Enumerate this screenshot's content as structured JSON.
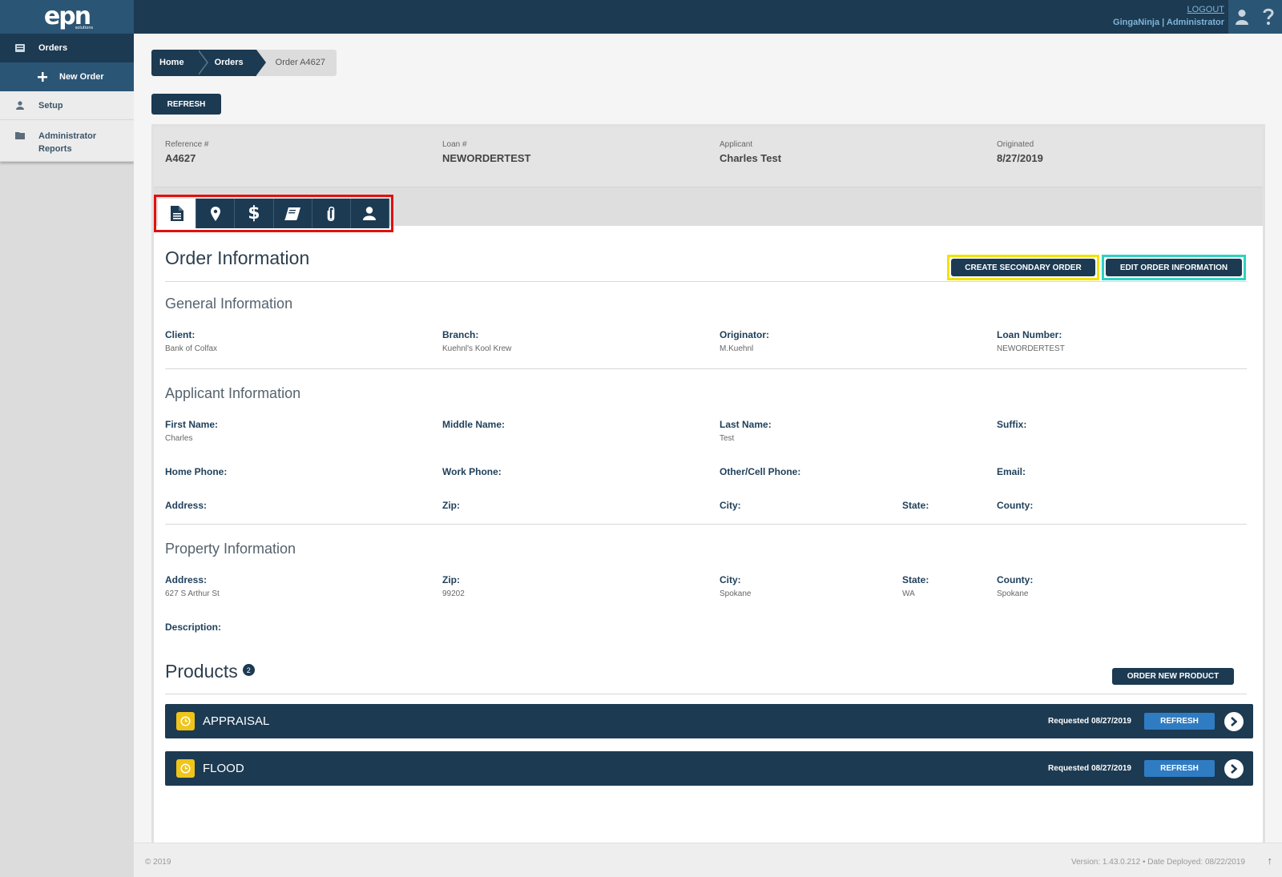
{
  "header": {
    "logo_text": "epn",
    "logo_sub": "solutions",
    "logout_label": "LOGOUT",
    "user_line": "GingaNinja | Administrator",
    "user_icon": "user-icon",
    "help_icon": "help-icon"
  },
  "sidebar": {
    "items": [
      {
        "label": "Orders",
        "icon": "orders-icon"
      },
      {
        "label": "New Order",
        "icon": "plus-icon"
      },
      {
        "label": "Setup",
        "icon": "user-icon"
      },
      {
        "label": "Administrator Reports",
        "icon": "folder-icon"
      }
    ]
  },
  "breadcrumb": {
    "home": "Home",
    "orders": "Orders",
    "current": "Order A4627"
  },
  "toolbar": {
    "refresh_label": "REFRESH"
  },
  "summary": {
    "reference": {
      "label": "Reference #",
      "value": "A4627"
    },
    "loan": {
      "label": "Loan #",
      "value": "NEWORDERTEST"
    },
    "applicant": {
      "label": "Applicant",
      "value": "Charles Test"
    },
    "originated": {
      "label": "Originated",
      "value": "8/27/2019"
    }
  },
  "tabs": [
    {
      "icon": "document-icon",
      "active": true
    },
    {
      "icon": "map-pin-icon"
    },
    {
      "icon": "dollar-icon"
    },
    {
      "icon": "book-icon"
    },
    {
      "icon": "paperclip-icon"
    },
    {
      "icon": "user-icon"
    }
  ],
  "order": {
    "title": "Order Information",
    "create_secondary_label": "CREATE SECONDARY ORDER",
    "edit_label": "EDIT ORDER INFORMATION",
    "general": {
      "title": "General Information",
      "client": {
        "label": "Client:",
        "value": "Bank of Colfax"
      },
      "branch": {
        "label": "Branch:",
        "value": "Kuehnl's Kool Krew"
      },
      "originator": {
        "label": "Originator:",
        "value": "M.Kuehnl"
      },
      "loan_number": {
        "label": "Loan Number:",
        "value": "NEWORDERTEST"
      }
    },
    "applicant": {
      "title": "Applicant Information",
      "first_name": {
        "label": "First Name:",
        "value": "Charles"
      },
      "middle_name": {
        "label": "Middle Name:",
        "value": ""
      },
      "last_name": {
        "label": "Last Name:",
        "value": "Test"
      },
      "suffix": {
        "label": "Suffix:",
        "value": ""
      },
      "home_phone": {
        "label": "Home Phone:",
        "value": ""
      },
      "work_phone": {
        "label": "Work Phone:",
        "value": ""
      },
      "other_phone": {
        "label": "Other/Cell Phone:",
        "value": ""
      },
      "email": {
        "label": "Email:",
        "value": ""
      },
      "address": {
        "label": "Address:",
        "value": ""
      },
      "zip": {
        "label": "Zip:",
        "value": ""
      },
      "city": {
        "label": "City:",
        "value": ""
      },
      "state": {
        "label": "State:",
        "value": ""
      },
      "county": {
        "label": "County:",
        "value": ""
      }
    },
    "property": {
      "title": "Property Information",
      "address": {
        "label": "Address:",
        "value": "627 S Arthur St"
      },
      "zip": {
        "label": "Zip:",
        "value": "99202"
      },
      "city": {
        "label": "City:",
        "value": "Spokane"
      },
      "state": {
        "label": "State:",
        "value": "WA"
      },
      "county": {
        "label": "County:",
        "value": "Spokane"
      },
      "description": {
        "label": "Description:",
        "value": ""
      }
    }
  },
  "products": {
    "title": "Products",
    "count": "2",
    "order_new_label": "ORDER NEW PRODUCT",
    "items": [
      {
        "name": "APPRAISAL",
        "requested": "Requested 08/27/2019",
        "refresh_label": "REFRESH"
      },
      {
        "name": "FLOOD",
        "requested": "Requested 08/27/2019",
        "refresh_label": "REFRESH"
      }
    ]
  },
  "footer": {
    "copyright": "© 2019",
    "version": "Version: 1.43.0.212  •  Date Deployed: 08/22/2019",
    "up_icon": "arrow-up-icon"
  },
  "colors": {
    "navy": "#1c3a52",
    "highlight_red": "#e01010",
    "highlight_yellow": "#f2e200",
    "highlight_teal": "#2ed2c0",
    "status_yellow": "#f0c419",
    "refresh_blue": "#2f7cc2"
  }
}
